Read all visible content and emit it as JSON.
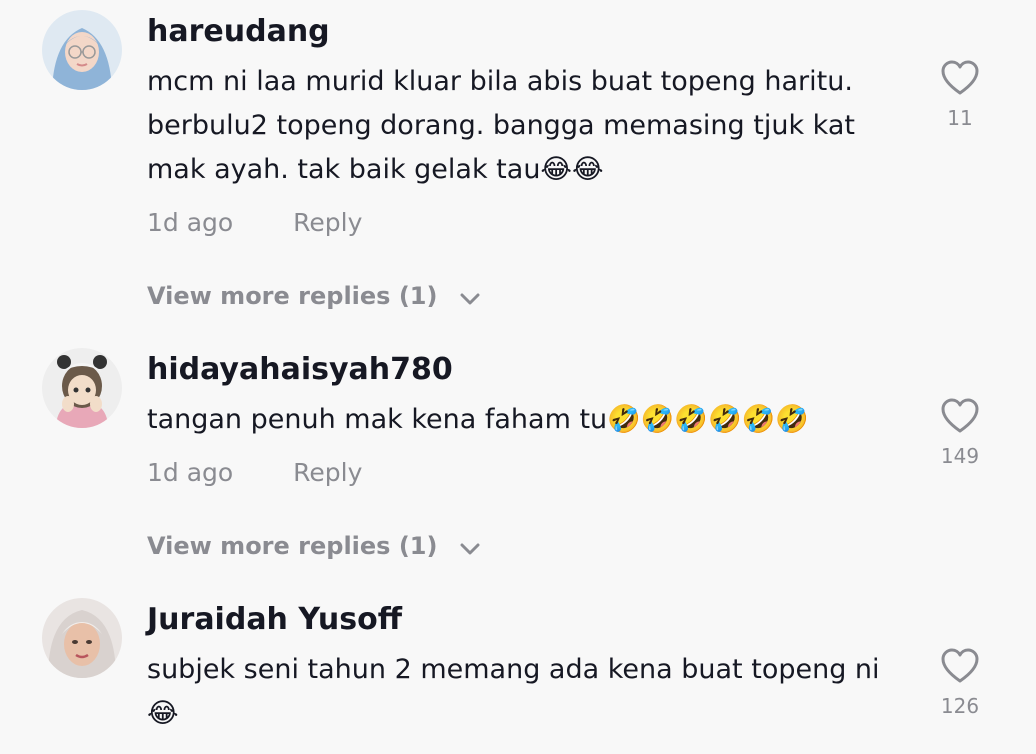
{
  "comments": [
    {
      "username": "hareudang",
      "text": "mcm ni laa murid kluar bila abis buat topeng haritu. berbulu2 topeng dorang. bangga memasing tjuk kat mak ayah. tak baik gelak tau😂😂",
      "time": "1d ago",
      "reply_label": "Reply",
      "view_replies": "View more replies (1)",
      "likes": "11"
    },
    {
      "username": "hidayahaisyah780",
      "text": "tangan penuh mak kena faham tu🤣🤣🤣🤣🤣🤣",
      "time": "1d ago",
      "reply_label": "Reply",
      "view_replies": "View more replies (1)",
      "likes": "149"
    },
    {
      "username": "Juraidah Yusoff",
      "text": "subjek seni tahun 2 memang ada kena buat topeng ni 😂",
      "likes": "126"
    }
  ],
  "icons": {
    "like": "heart-outline-icon",
    "expand": "chevron-down-icon"
  },
  "colors": {
    "background": "#f8f8f8",
    "primary_text": "#161823",
    "secondary_text": "#8a8b91"
  }
}
